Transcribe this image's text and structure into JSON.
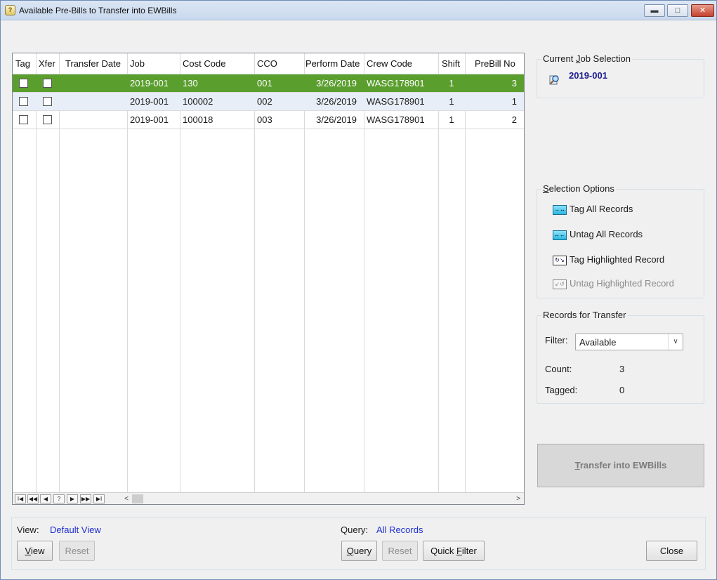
{
  "window": {
    "title": "Available Pre-Bills to Transfer into EWBills",
    "minimize": "▬",
    "maximize": "□",
    "close": "✕"
  },
  "grid": {
    "columns": [
      "Tag",
      "Xfer",
      "Transfer Date",
      "Job",
      "Cost Code",
      "CCO",
      "Perform Date",
      "Crew Code",
      "Shift",
      "PreBill No"
    ],
    "rows": [
      {
        "job": "2019-001",
        "cost_code": "130",
        "cco": "001",
        "perform_date": "3/26/2019",
        "crew_code": "WASG178901",
        "shift": "1",
        "prebill_no": "3"
      },
      {
        "job": "2019-001",
        "cost_code": "100002",
        "cco": "002",
        "perform_date": "3/26/2019",
        "crew_code": "WASG178901",
        "shift": "1",
        "prebill_no": "1"
      },
      {
        "job": "2019-001",
        "cost_code": "100018",
        "cco": "003",
        "perform_date": "3/26/2019",
        "crew_code": "WASG178901",
        "shift": "1",
        "prebill_no": "2"
      }
    ],
    "nav": [
      "I◀",
      "◀◀",
      "◀",
      "?",
      "▶",
      "▶▶",
      "▶I"
    ],
    "scroll_left": "<",
    "scroll_right": ">"
  },
  "current_job": {
    "legend_pre": "Current ",
    "legend_u": "J",
    "legend_post": "ob Selection",
    "value": "2019-001",
    "icon": "magnifier-icon"
  },
  "selection_options": {
    "legend_u": "S",
    "legend_post": "election Options",
    "items": [
      {
        "label": "Tag All Records",
        "icon": "tag-all-icon",
        "glyph": "→↔",
        "enabled": true
      },
      {
        "label": "Untag All Records",
        "icon": "untag-all-icon",
        "glyph": "↔←",
        "enabled": true
      },
      {
        "label": "Tag Highlighted Record",
        "icon": "tag-highlighted-icon",
        "glyph": "↻↘",
        "enabled": true
      },
      {
        "label": "Untag Highlighted Record",
        "icon": "untag-highlighted-icon",
        "glyph": "↙↺",
        "enabled": false
      }
    ]
  },
  "records_for_transfer": {
    "legend": "Records for Transfer",
    "filter_label": "Filter:",
    "filter_value": "Available",
    "count_label": "Count:",
    "count_value": "3",
    "tagged_label": "Tagged:",
    "tagged_value": "0"
  },
  "transfer_button": {
    "u": "T",
    "rest": "ransfer into EWBills"
  },
  "bottom": {
    "view_label": "View:",
    "view_value": "Default View",
    "query_label": "Query:",
    "query_value": "All Records",
    "view_btn_u": "V",
    "view_btn_rest": "iew",
    "reset_btn": "Reset",
    "query_btn_pre": "",
    "query_btn_u": "Q",
    "query_btn_rest": "uery",
    "reset2_btn": "Reset",
    "quick_filter_pre": "Quick ",
    "quick_filter_u": "F",
    "quick_filter_rest": "ilter",
    "close_btn": "Close"
  },
  "colors": {
    "selected_row": "#5a9e2e",
    "alt_row": "#e8eef8",
    "link": "#1e2fd0",
    "job_value": "#1c1c8c"
  }
}
